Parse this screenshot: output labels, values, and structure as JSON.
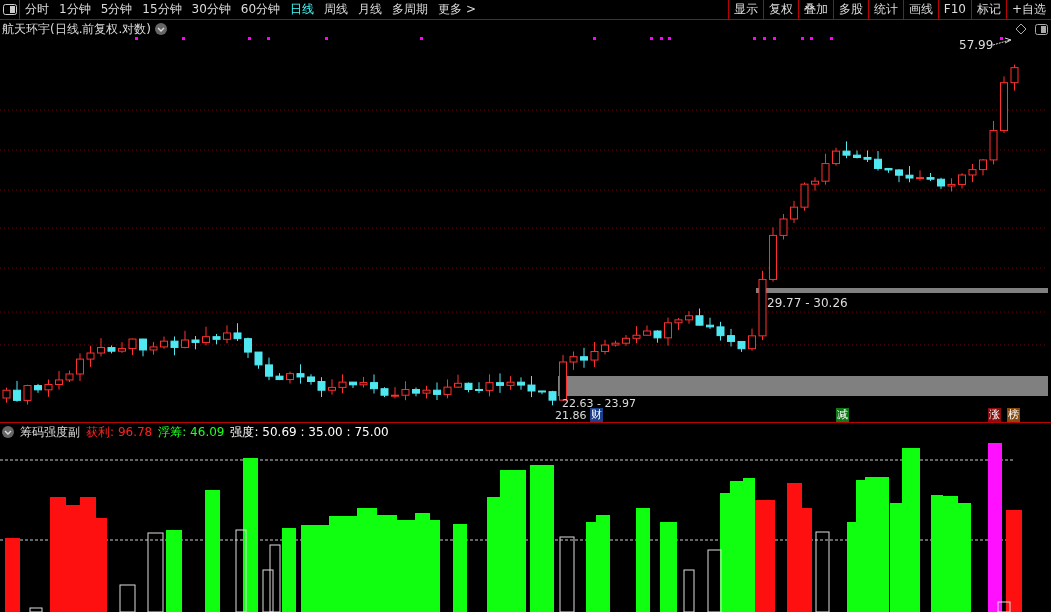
{
  "toolbar": {
    "periods": [
      {
        "label": "分时",
        "selected": false
      },
      {
        "label": "1分钟",
        "selected": false
      },
      {
        "label": "5分钟",
        "selected": false
      },
      {
        "label": "15分钟",
        "selected": false
      },
      {
        "label": "30分钟",
        "selected": false
      },
      {
        "label": "60分钟",
        "selected": false
      },
      {
        "label": "日线",
        "selected": true
      },
      {
        "label": "周线",
        "selected": false
      },
      {
        "label": "月线",
        "selected": false
      },
      {
        "label": "多周期",
        "selected": false
      },
      {
        "label": "更多 >",
        "selected": false
      }
    ],
    "tools": [
      "显示",
      "复权",
      "叠加",
      "多股",
      "统计",
      "画线",
      "F10",
      "标记",
      "+自选"
    ]
  },
  "chart": {
    "title": "航天环宇(日线.前复权.对数)",
    "high_label": "57.99",
    "upper_range": "29.77 - 30.26",
    "lower_range": "22.63 - 23.97",
    "low_label": "21.86",
    "events": [
      {
        "label": "财",
        "color": "#1c3f8a"
      },
      {
        "label": "减",
        "color": "#11781a"
      },
      {
        "label": "涨",
        "color": "#8a0c0c"
      },
      {
        "label": "榜",
        "color": "#8a4a0c"
      }
    ]
  },
  "indicator": {
    "name": "筹码强度副",
    "values": [
      {
        "label": "获利:",
        "value": "96.78",
        "color": "#ff2020"
      },
      {
        "label": "浮筹:",
        "value": "46.09",
        "color": "#20ff20"
      },
      {
        "label": "强度:",
        "value": "50.69 : 35.00 : 75.00",
        "color": "#ffffff"
      }
    ]
  }
}
